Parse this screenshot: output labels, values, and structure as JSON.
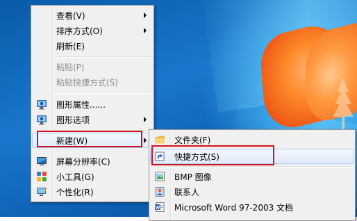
{
  "menu": {
    "items": [
      {
        "label": "查看(V)",
        "submenu": true
      },
      {
        "label": "排序方式(O)",
        "submenu": true
      },
      {
        "label": "刷新(E)"
      },
      {
        "label": "粘贴(P)",
        "disabled": true
      },
      {
        "label": "粘贴快捷方式(S)",
        "disabled": true
      },
      {
        "label": "图形属性......",
        "icon": "graphics-properties-icon"
      },
      {
        "label": "图形选项",
        "icon": "graphics-options-icon",
        "submenu": true
      },
      {
        "label": "新建(W)",
        "submenu": true,
        "highlighted": true
      },
      {
        "label": "屏幕分辨率(C)",
        "icon": "screen-resolution-icon"
      },
      {
        "label": "小工具(G)",
        "icon": "gadgets-icon"
      },
      {
        "label": "个性化(R)",
        "icon": "personalize-icon"
      }
    ]
  },
  "submenu": {
    "items": [
      {
        "label": "文件夹(F)",
        "icon": "folder-icon"
      },
      {
        "label": "快捷方式(S)",
        "icon": "shortcut-icon",
        "highlighted": true
      },
      {
        "label": "BMP 图像",
        "icon": "bmp-image-icon"
      },
      {
        "label": "联系人",
        "icon": "contact-icon"
      },
      {
        "label": "Microsoft Word 97-2003 文档",
        "icon": "word-document-icon"
      }
    ]
  },
  "colors": {
    "highlight_box": "#d1141b",
    "menu_bg": "#f0f0f0"
  }
}
